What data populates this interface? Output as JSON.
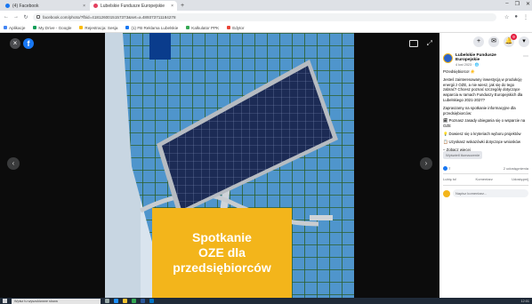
{
  "browser": {
    "tabs": [
      {
        "label": "(4) Facebook",
        "active": false,
        "color": "#1877f2"
      },
      {
        "label": "Lubelskie Fundusze Europejskie",
        "active": true,
        "color": "#e4405f"
      }
    ],
    "new_tab": "+",
    "address": "facebook.com/photo/?fbid=4181260015157373&set=a.489373711184278",
    "bookmarks": [
      {
        "label": "Aplikacje",
        "color": "#4285f4"
      },
      {
        "label": "My Drive - Google",
        "color": "#0f9d58"
      },
      {
        "label": "Rejestracja: Sesja",
        "color": "#fbbc05"
      },
      {
        "label": "(1) FB Reklama Lubelskie",
        "color": "#1877f2"
      },
      {
        "label": "Kalkulator PPK",
        "color": "#34a853"
      },
      {
        "label": "Edytor",
        "color": "#ea4335"
      }
    ]
  },
  "viewer": {
    "close_icon": "×",
    "fb_logo": "f",
    "prev": "‹",
    "next": "›",
    "photo_caption": [
      "Spotkanie",
      "OZE dla",
      "przedsiębiorców"
    ]
  },
  "panel": {
    "page_name": "Lubelskie Fundusze Europejskie",
    "post_meta": "4 kwi 2023 · 🌐",
    "notification_count": "9",
    "text": [
      "Przedsiębiorco! ☀️",
      "Jesteś zainteresowany inwestycją w produkcję energii z OZE, a nie wiesz, jak się do tego zabrać? Chcesz poznać szczegóły dotyczące wsparcia w ramach Funduszy Europejskich dla Lubelskiego 2021-2027?",
      "Zapraszamy na spotkanie informacyjne dla przedsiębiorców:",
      "🗓 Poznasz zasady ubiegania się o wsparcie na OZE",
      "💡 Dowiesz się o kryteriach wyboru projektów",
      "📋 Uzyskasz wskazówki dotyczące wniosków",
      "– Zobacz więcej"
    ],
    "translate": "Wyświetl tłumaczenie",
    "likes": "7",
    "shares": "2 udostępnienia",
    "actions": [
      "Lubię to!",
      "Komentarz",
      "Udostępnij"
    ],
    "comment_placeholder": "Napisz komentarz..."
  },
  "taskbar": {
    "search": "Wpisz tu wyszukiwane słowa",
    "time": "12:01"
  }
}
